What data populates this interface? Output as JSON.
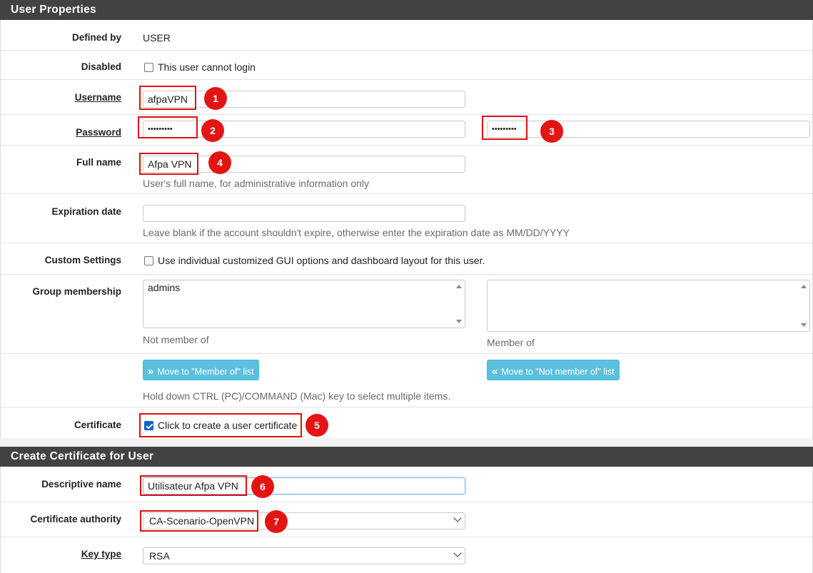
{
  "user_properties": {
    "title": "User Properties",
    "defined_by": {
      "label": "Defined by",
      "value": "USER"
    },
    "disabled": {
      "label": "Disabled",
      "checkbox_label": "This user cannot login",
      "checked": false
    },
    "username": {
      "label": "Username",
      "value": "afpaVPN"
    },
    "password": {
      "label": "Password",
      "value": "•••••••••",
      "confirm_value": "•••••••••"
    },
    "full_name": {
      "label": "Full name",
      "value": "Afpa VPN",
      "help": "User's full name, for administrative information only"
    },
    "expiration_date": {
      "label": "Expiration date",
      "value": "",
      "help": "Leave blank if the account shouldn't expire, otherwise enter the expiration date as MM/DD/YYYY"
    },
    "custom_settings": {
      "label": "Custom Settings",
      "checkbox_label": "Use individual customized GUI options and dashboard layout for this user.",
      "checked": false
    },
    "group_membership": {
      "label": "Group membership",
      "not_member_items": [
        "admins"
      ],
      "not_member_caption": "Not member of",
      "member_items": [],
      "member_caption": "Member of",
      "move_to_member_button": "Move to \"Member of\" list",
      "move_to_not_member_button": "Move to \"Not member of\" list",
      "help": "Hold down CTRL (PC)/COMMAND (Mac) key to select multiple items."
    },
    "certificate": {
      "label": "Certificate",
      "checkbox_label": "Click to create a user certificate",
      "checked": true
    }
  },
  "create_certificate": {
    "title": "Create Certificate for User",
    "descriptive_name": {
      "label": "Descriptive name",
      "value": "Utilisateur Afpa VPN"
    },
    "certificate_authority": {
      "label": "Certificate authority",
      "value": "CA-Scenario-OpenVPN"
    },
    "key_type": {
      "label": "Key type",
      "value": "RSA"
    }
  },
  "annotations": {
    "markers": [
      "1",
      "2",
      "3",
      "4",
      "5",
      "6",
      "7"
    ],
    "color": "#e41414"
  },
  "colors": {
    "header_bg": "#424242",
    "info_button": "#5bc0de",
    "checkbox_checked": "#0b63c5"
  }
}
